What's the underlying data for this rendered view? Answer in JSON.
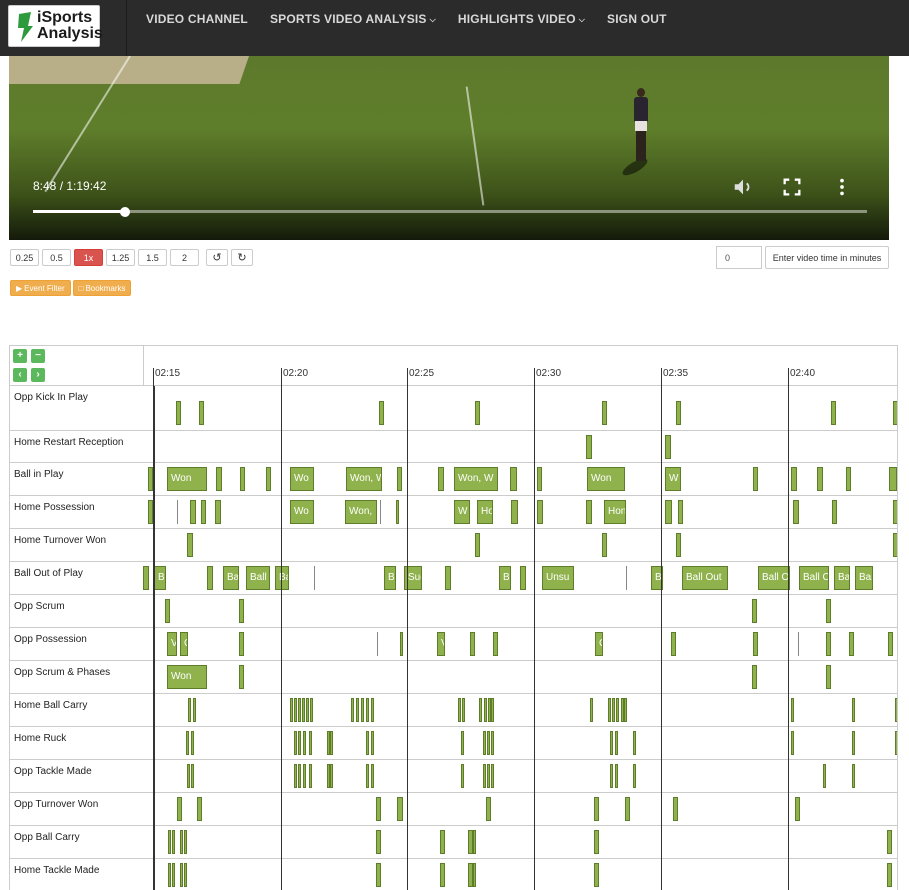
{
  "nav": {
    "logo_line1": "iSports",
    "logo_line2": "Analysis",
    "items": [
      {
        "label": "VIDEO CHANNEL",
        "dropdown": false
      },
      {
        "label": "SPORTS VIDEO ANALYSIS",
        "dropdown": true
      },
      {
        "label": "HIGHLIGHTS VIDEO",
        "dropdown": true
      },
      {
        "label": "SIGN OUT",
        "dropdown": false
      }
    ]
  },
  "video": {
    "time": "8:48 / 1:19:42",
    "progress_fraction": 0.11,
    "icons": [
      "volume-icon",
      "fullscreen-icon",
      "more-icon"
    ]
  },
  "speed": {
    "options": [
      "0.25",
      "0.5",
      "1x",
      "1.25",
      "1.5",
      "2"
    ],
    "active": "1x"
  },
  "time_jump": {
    "value": "0",
    "button_label": "Enter video time in minutes"
  },
  "filters": {
    "event_filter": "Event Filter",
    "bookmarks": "Bookmarks"
  },
  "timeline": {
    "ticks": [
      "02:15",
      "02:20",
      "02:25",
      "02:30",
      "02:35",
      "02:40"
    ],
    "rows": [
      {
        "label": "Opp Kick In Play"
      },
      {
        "label": "Home Restart Reception"
      },
      {
        "label": "Ball in Play"
      },
      {
        "label": "Home Possession"
      },
      {
        "label": "Home Turnover Won"
      },
      {
        "label": "Ball Out of Play"
      },
      {
        "label": "Opp Scrum"
      },
      {
        "label": "Opp Possession"
      },
      {
        "label": "Opp Scrum & Phases"
      },
      {
        "label": "Home Ball Carry"
      },
      {
        "label": "Home Ruck"
      },
      {
        "label": "Opp Tackle Made"
      },
      {
        "label": "Opp Turnover Won"
      },
      {
        "label": "Opp Ball Carry"
      },
      {
        "label": "Home Tackle Made"
      }
    ],
    "event_texts": {
      "ball_in_play": [
        "Won",
        "Wo",
        "Won, W",
        "Won, W",
        "Won",
        "W"
      ],
      "home_possession": [
        "Wo",
        "Won,",
        "W",
        "Ho",
        "Hon"
      ],
      "ball_out_of_play": [
        "Ba",
        "Ba",
        "Ball",
        "Ba",
        "Ba",
        "Suc",
        "Ba",
        "Unsu",
        "Ba",
        "Ball Out",
        "Ball O",
        "Ball C",
        "Ba",
        "Ba"
      ],
      "opp_possession": [
        "V",
        "C",
        "V",
        "C"
      ],
      "opp_scrum_phases": [
        "Won"
      ]
    }
  }
}
